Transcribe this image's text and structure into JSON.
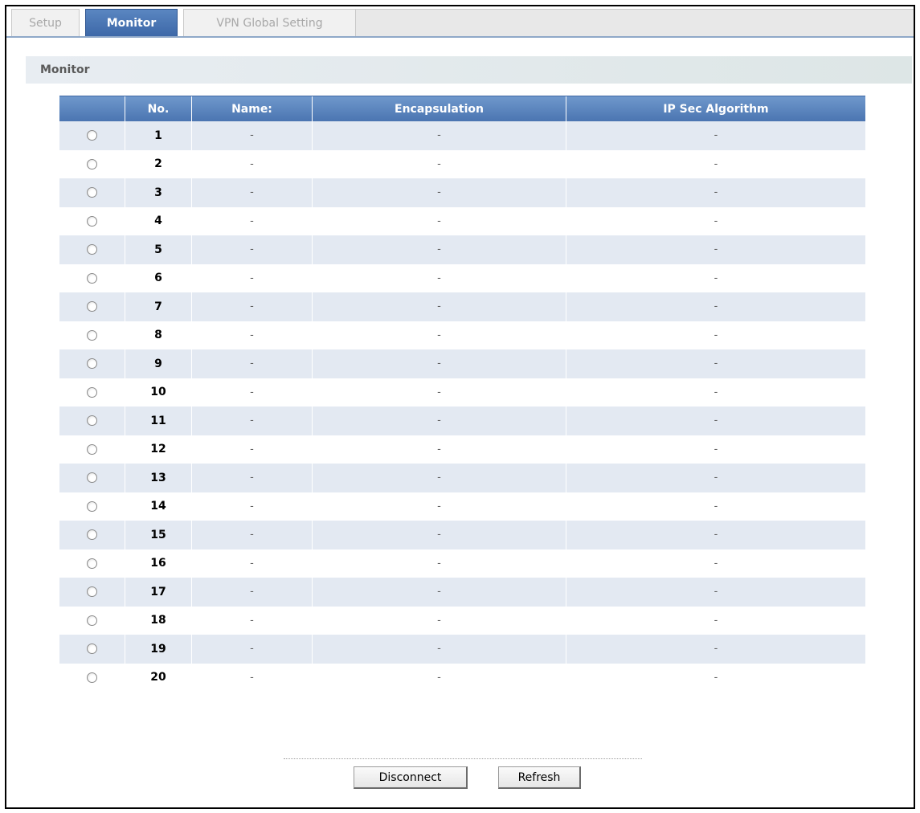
{
  "tabs": {
    "setup": "Setup",
    "monitor": "Monitor",
    "vpn_global": "VPN Global Setting"
  },
  "section": {
    "title": "Monitor"
  },
  "table": {
    "headers": {
      "select": "",
      "no": "No.",
      "name": "Name:",
      "encapsulation": "Encapsulation",
      "ipsec": "IP Sec Algorithm"
    },
    "rows": [
      {
        "no": "1",
        "name": "-",
        "encapsulation": "-",
        "ipsec": "-"
      },
      {
        "no": "2",
        "name": "-",
        "encapsulation": "-",
        "ipsec": "-"
      },
      {
        "no": "3",
        "name": "-",
        "encapsulation": "-",
        "ipsec": "-"
      },
      {
        "no": "4",
        "name": "-",
        "encapsulation": "-",
        "ipsec": "-"
      },
      {
        "no": "5",
        "name": "-",
        "encapsulation": "-",
        "ipsec": "-"
      },
      {
        "no": "6",
        "name": "-",
        "encapsulation": "-",
        "ipsec": "-"
      },
      {
        "no": "7",
        "name": "-",
        "encapsulation": "-",
        "ipsec": "-"
      },
      {
        "no": "8",
        "name": "-",
        "encapsulation": "-",
        "ipsec": "-"
      },
      {
        "no": "9",
        "name": "-",
        "encapsulation": "-",
        "ipsec": "-"
      },
      {
        "no": "10",
        "name": "-",
        "encapsulation": "-",
        "ipsec": "-"
      },
      {
        "no": "11",
        "name": "-",
        "encapsulation": "-",
        "ipsec": "-"
      },
      {
        "no": "12",
        "name": "-",
        "encapsulation": "-",
        "ipsec": "-"
      },
      {
        "no": "13",
        "name": "-",
        "encapsulation": "-",
        "ipsec": "-"
      },
      {
        "no": "14",
        "name": "-",
        "encapsulation": "-",
        "ipsec": "-"
      },
      {
        "no": "15",
        "name": "-",
        "encapsulation": "-",
        "ipsec": "-"
      },
      {
        "no": "16",
        "name": "-",
        "encapsulation": "-",
        "ipsec": "-"
      },
      {
        "no": "17",
        "name": "-",
        "encapsulation": "-",
        "ipsec": "-"
      },
      {
        "no": "18",
        "name": "-",
        "encapsulation": "-",
        "ipsec": "-"
      },
      {
        "no": "19",
        "name": "-",
        "encapsulation": "-",
        "ipsec": "-"
      },
      {
        "no": "20",
        "name": "-",
        "encapsulation": "-",
        "ipsec": "-"
      }
    ]
  },
  "buttons": {
    "disconnect": "Disconnect",
    "refresh": "Refresh"
  },
  "colors": {
    "tab_active": "#4b75b1",
    "header": "#5a86c1",
    "row_alt": "#e3e9f2"
  }
}
